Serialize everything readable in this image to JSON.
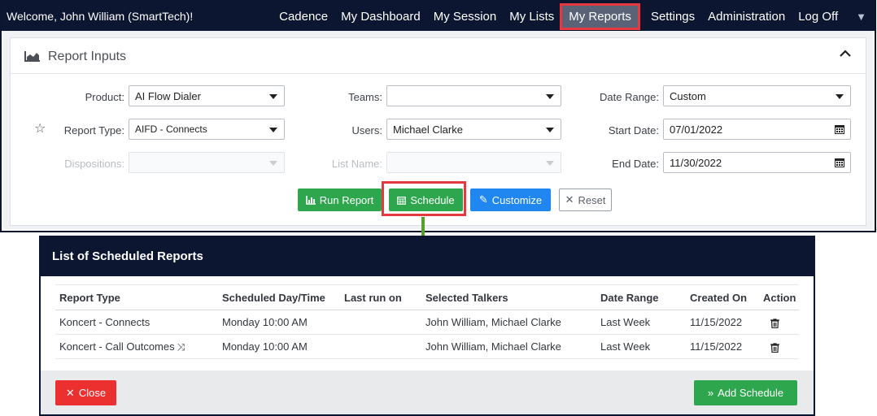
{
  "topbar": {
    "welcome": "Welcome, John William (SmartTech)!",
    "nav": [
      "Cadence",
      "My Dashboard",
      "My Session",
      "My Lists",
      "My Reports",
      "Settings",
      "Administration",
      "Log Off"
    ],
    "active": "My Reports"
  },
  "report_inputs": {
    "title": "Report Inputs",
    "product": {
      "label": "Product:",
      "value": "AI Flow Dialer"
    },
    "report_type": {
      "label": "Report Type:",
      "value": "AIFD - Connects"
    },
    "dispositions": {
      "label": "Dispositions:",
      "value": ""
    },
    "teams": {
      "label": "Teams:",
      "value": ""
    },
    "users": {
      "label": "Users:",
      "value": "Michael Clarke"
    },
    "list_name": {
      "label": "List Name:",
      "value": ""
    },
    "date_range": {
      "label": "Date Range:",
      "value": "Custom"
    },
    "start_date": {
      "label": "Start Date:",
      "value": "07/01/2022"
    },
    "end_date": {
      "label": "End Date:",
      "value": "11/30/2022"
    },
    "buttons": {
      "run": "Run Report",
      "schedule": "Schedule",
      "customize": "Customize",
      "reset": "Reset"
    }
  },
  "modal": {
    "title": "List of Scheduled Reports",
    "columns": [
      "Report Type",
      "Scheduled Day/Time",
      "Last run on",
      "Selected Talkers",
      "Date Range",
      "Created On",
      "Action"
    ],
    "rows": [
      {
        "report_type": "Koncert - Connects",
        "scheduled": "Monday 10:00 AM",
        "last_run": "",
        "talkers": "John William, Michael Clarke",
        "date_range": "Last Week",
        "created": "11/15/2022"
      },
      {
        "report_type": "Koncert - Call Outcomes",
        "scheduled": "Monday 10:00 AM",
        "last_run": "",
        "talkers": "John William, Michael Clarke",
        "date_range": "Last Week",
        "created": "11/15/2022"
      }
    ],
    "close_label": "Close",
    "add_label": "Add Schedule"
  },
  "colors": {
    "navy": "#0c1631",
    "green": "#2ea64d",
    "blue": "#2087f0",
    "red": "#ec2f2f",
    "highlight": "#e5393f"
  }
}
